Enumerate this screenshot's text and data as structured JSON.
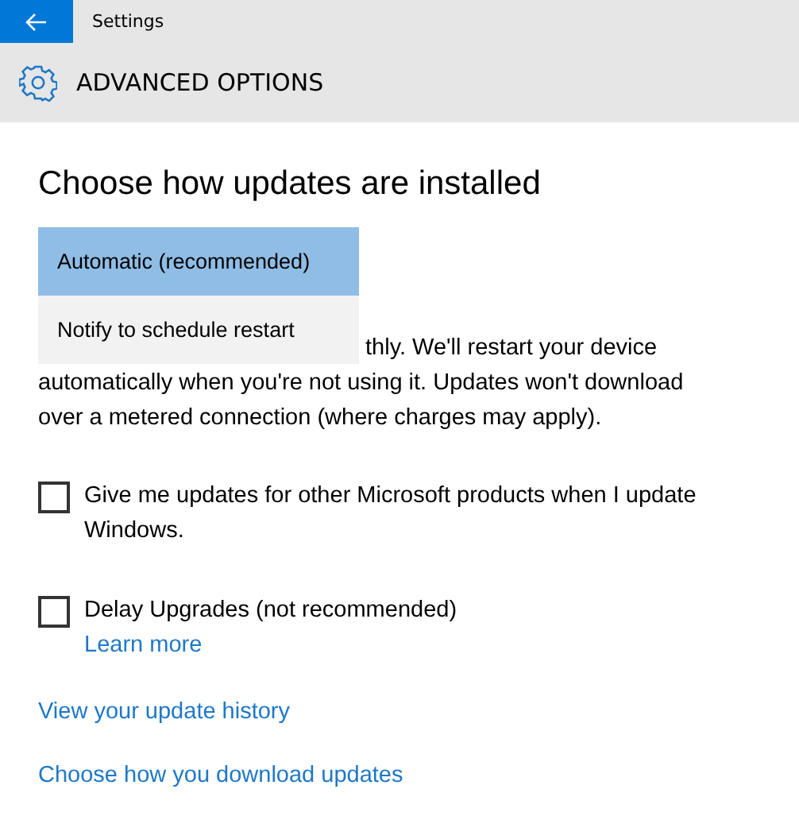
{
  "window": {
    "title": "Settings"
  },
  "page": {
    "title": "ADVANCED OPTIONS"
  },
  "heading": "Choose how updates are installed",
  "dropdown": {
    "options": [
      {
        "label": "Automatic (recommended)",
        "selected": true
      },
      {
        "label": "Notify to schedule restart",
        "selected": false
      }
    ]
  },
  "description_lines": [
    "thly. We'll restart your device",
    "automatically when you're not using it. Updates won't download",
    "over a metered connection (where charges may apply)."
  ],
  "checkboxes": [
    {
      "label": "Give me updates for other Microsoft products when I update Windows.",
      "checked": false
    },
    {
      "label": "Delay Upgrades (not recommended)",
      "checked": false,
      "link": "Learn more"
    }
  ],
  "links": [
    "View your update history",
    "Choose how you download updates"
  ]
}
